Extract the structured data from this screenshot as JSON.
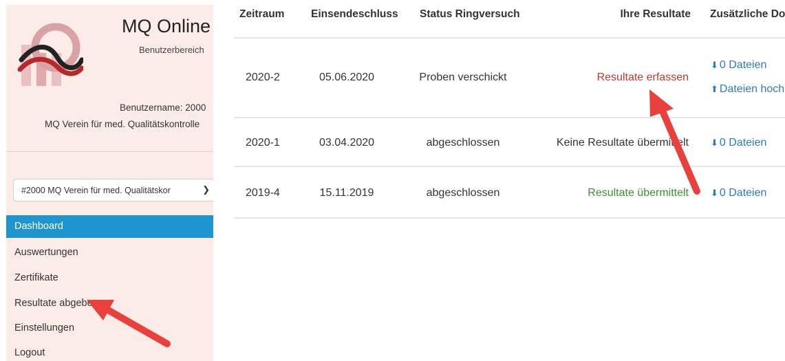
{
  "header": {
    "title": "MQ Online",
    "subtitle": "Benutzerbereich",
    "username_line": "Benutzername: 2000",
    "org_line": "MQ Verein für med. Qualitätskontrolle"
  },
  "org_select": {
    "value": "#2000 MQ Verein für med. Qualitätskor"
  },
  "nav": {
    "items": [
      {
        "label": "Dashboard"
      },
      {
        "label": "Auswertungen"
      },
      {
        "label": "Zertifikate"
      },
      {
        "label": "Resultate abgeben"
      },
      {
        "label": "Einstellungen"
      },
      {
        "label": "Logout"
      }
    ],
    "active_index": 0
  },
  "table": {
    "headers": [
      "Zeitraum",
      "Einsendeschluss",
      "Status Ringversuch",
      "Ihre Resultate",
      "Zusätzliche Dok"
    ],
    "rows": [
      {
        "zeitraum": "2020-2",
        "einsendeschluss": "05.06.2020",
        "status": "Proben verschickt",
        "resultate": "Resultate erfassen",
        "files": "0 Dateien",
        "upload": "Dateien hoch"
      },
      {
        "zeitraum": "2020-1",
        "einsendeschluss": "03.04.2020",
        "status": "abgeschlossen",
        "resultate": "Keine Resultate übermittelt",
        "files": "0 Dateien"
      },
      {
        "zeitraum": "2019-4",
        "einsendeschluss": "15.11.2019",
        "status": "abgeschlossen",
        "resultate": "Resultate übermittelt",
        "files": "0 Dateien"
      }
    ]
  },
  "colors": {
    "sidebar_bg": "#fbece8",
    "active_nav": "#1e95cf",
    "link_red": "#c0392b",
    "link_green": "#3a8f2e",
    "link_blue": "#2a7bbf",
    "annotation_arrow": "#e8413c"
  },
  "icons": {
    "download": "download-icon",
    "upload": "upload-icon",
    "dropdown": "chevron-down-icon"
  }
}
